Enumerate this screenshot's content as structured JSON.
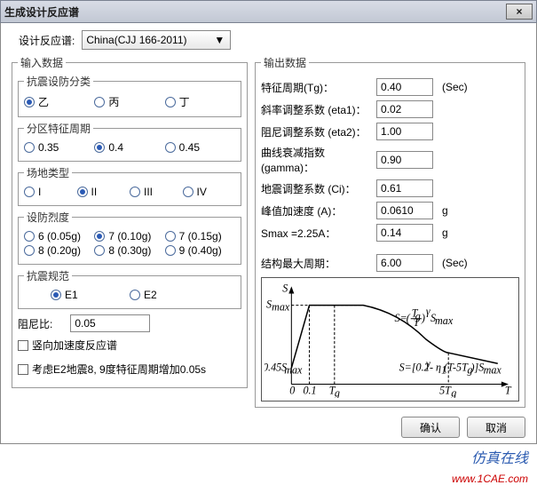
{
  "title": "生成设计反应谱",
  "close": "×",
  "spectrum_label": "设计反应谱:",
  "spectrum_value": "China(CJJ 166-2011)",
  "input": {
    "legend": "输入数据",
    "seismic_class": {
      "legend": "抗震设防分类",
      "opts": [
        "乙",
        "丙",
        "丁"
      ],
      "sel": 0
    },
    "char_period": {
      "legend": "分区特征周期",
      "opts": [
        "0.35",
        "0.4",
        "0.45"
      ],
      "sel": 1
    },
    "site_type": {
      "legend": "场地类型",
      "opts": [
        "I",
        "II",
        "III",
        "IV"
      ],
      "sel": 1
    },
    "intensity": {
      "legend": "设防烈度",
      "opts": [
        "6 (0.05g)",
        "7 (0.10g)",
        "7 (0.15g)",
        "8 (0.20g)",
        "8 (0.30g)",
        "9 (0.40g)"
      ],
      "sel": 1
    },
    "code": {
      "legend": "抗震规范",
      "opts": [
        "E1",
        "E2"
      ],
      "sel": 0
    },
    "damping_label": "阻尼比:",
    "damping_value": "0.05",
    "vertical_label": "竖向加速度反应谱",
    "consider_label": "考虑E2地震8, 9度特征周期增加0.05s"
  },
  "output": {
    "legend": "输出数据",
    "tg": {
      "label": "特征周期(Tg)：",
      "value": "0.40",
      "unit": "(Sec)"
    },
    "eta1": {
      "label": "斜率调整系数 (eta1)：",
      "value": "0.02",
      "unit": ""
    },
    "eta2": {
      "label": "阻尼调整系数 (eta2)：",
      "value": "1.00",
      "unit": ""
    },
    "gamma": {
      "label": "曲线衰减指数 (gamma)：",
      "value": "0.90",
      "unit": ""
    },
    "ci": {
      "label": "地震调整系数 (Ci)：",
      "value": "0.61",
      "unit": ""
    },
    "a": {
      "label": "峰值加速度 (A)：",
      "value": "0.0610",
      "unit": "g"
    },
    "smax": {
      "label": "Smax =2.25A：",
      "value": "0.14",
      "unit": "g"
    },
    "tmax": {
      "label": "结构最大周期：",
      "value": "6.00",
      "unit": "(Sec)"
    }
  },
  "chart_data": {
    "type": "line",
    "xlabel": "T",
    "ylabel": "S",
    "x_ticks": [
      "0",
      "0.1",
      "Tg",
      "5Tg"
    ],
    "y_ticks": [
      "0.45Smax",
      "Smax"
    ],
    "annotations": [
      "S=(Tg/T)^γ Smax",
      "S=[0.2^γ - η1(T-5Tg)]Smax"
    ]
  },
  "ok_label": "确认",
  "cancel_label": "取消",
  "watermark": "仿真在线",
  "watermark_url": "www.1CAE.com"
}
